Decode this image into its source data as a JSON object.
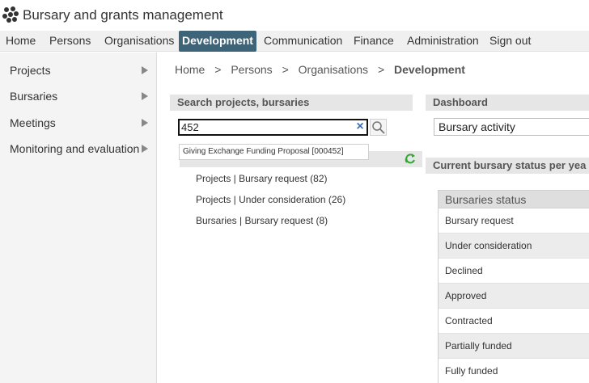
{
  "app": {
    "title": "Bursary and grants management"
  },
  "topnav": {
    "items": [
      {
        "label": "Home"
      },
      {
        "label": "Persons"
      },
      {
        "label": "Organisations"
      },
      {
        "label": "Development",
        "active": true
      },
      {
        "label": "Communication"
      },
      {
        "label": "Finance"
      },
      {
        "label": "Administration"
      },
      {
        "label": "Sign out"
      }
    ]
  },
  "sidebar": {
    "items": [
      {
        "label": "Projects"
      },
      {
        "label": "Bursaries"
      },
      {
        "label": "Meetings"
      },
      {
        "label": "Monitoring and evaluation"
      }
    ]
  },
  "breadcrumb": {
    "items": [
      "Home",
      ">",
      "Persons",
      ">",
      "Organisations",
      ">"
    ],
    "current": "Development"
  },
  "search": {
    "header": "Search projects, bursaries",
    "value": "452",
    "suggestion": "Giving Exchange Funding Proposal [000452]"
  },
  "workflow": {
    "items": [
      {
        "label": "Projects | Bursary request (82)"
      },
      {
        "label": "Projects | Under consideration (26)"
      },
      {
        "label": "Bursaries | Bursary request (8)"
      }
    ]
  },
  "dashboard": {
    "header": "Dashboard",
    "selected": "Bursary activity",
    "status_header": "Current bursary status per yea"
  },
  "status_table": {
    "header": "Bursaries status",
    "rows": [
      {
        "label": "Bursary request"
      },
      {
        "label": "Under consideration"
      },
      {
        "label": "Declined"
      },
      {
        "label": "Approved"
      },
      {
        "label": "Contracted"
      },
      {
        "label": "Partially funded"
      },
      {
        "label": "Fully funded"
      }
    ]
  },
  "colors": {
    "nav_active": "#3d6478",
    "accent_blue": "#3d6fb0",
    "refresh_green": "#2eaa2e"
  }
}
